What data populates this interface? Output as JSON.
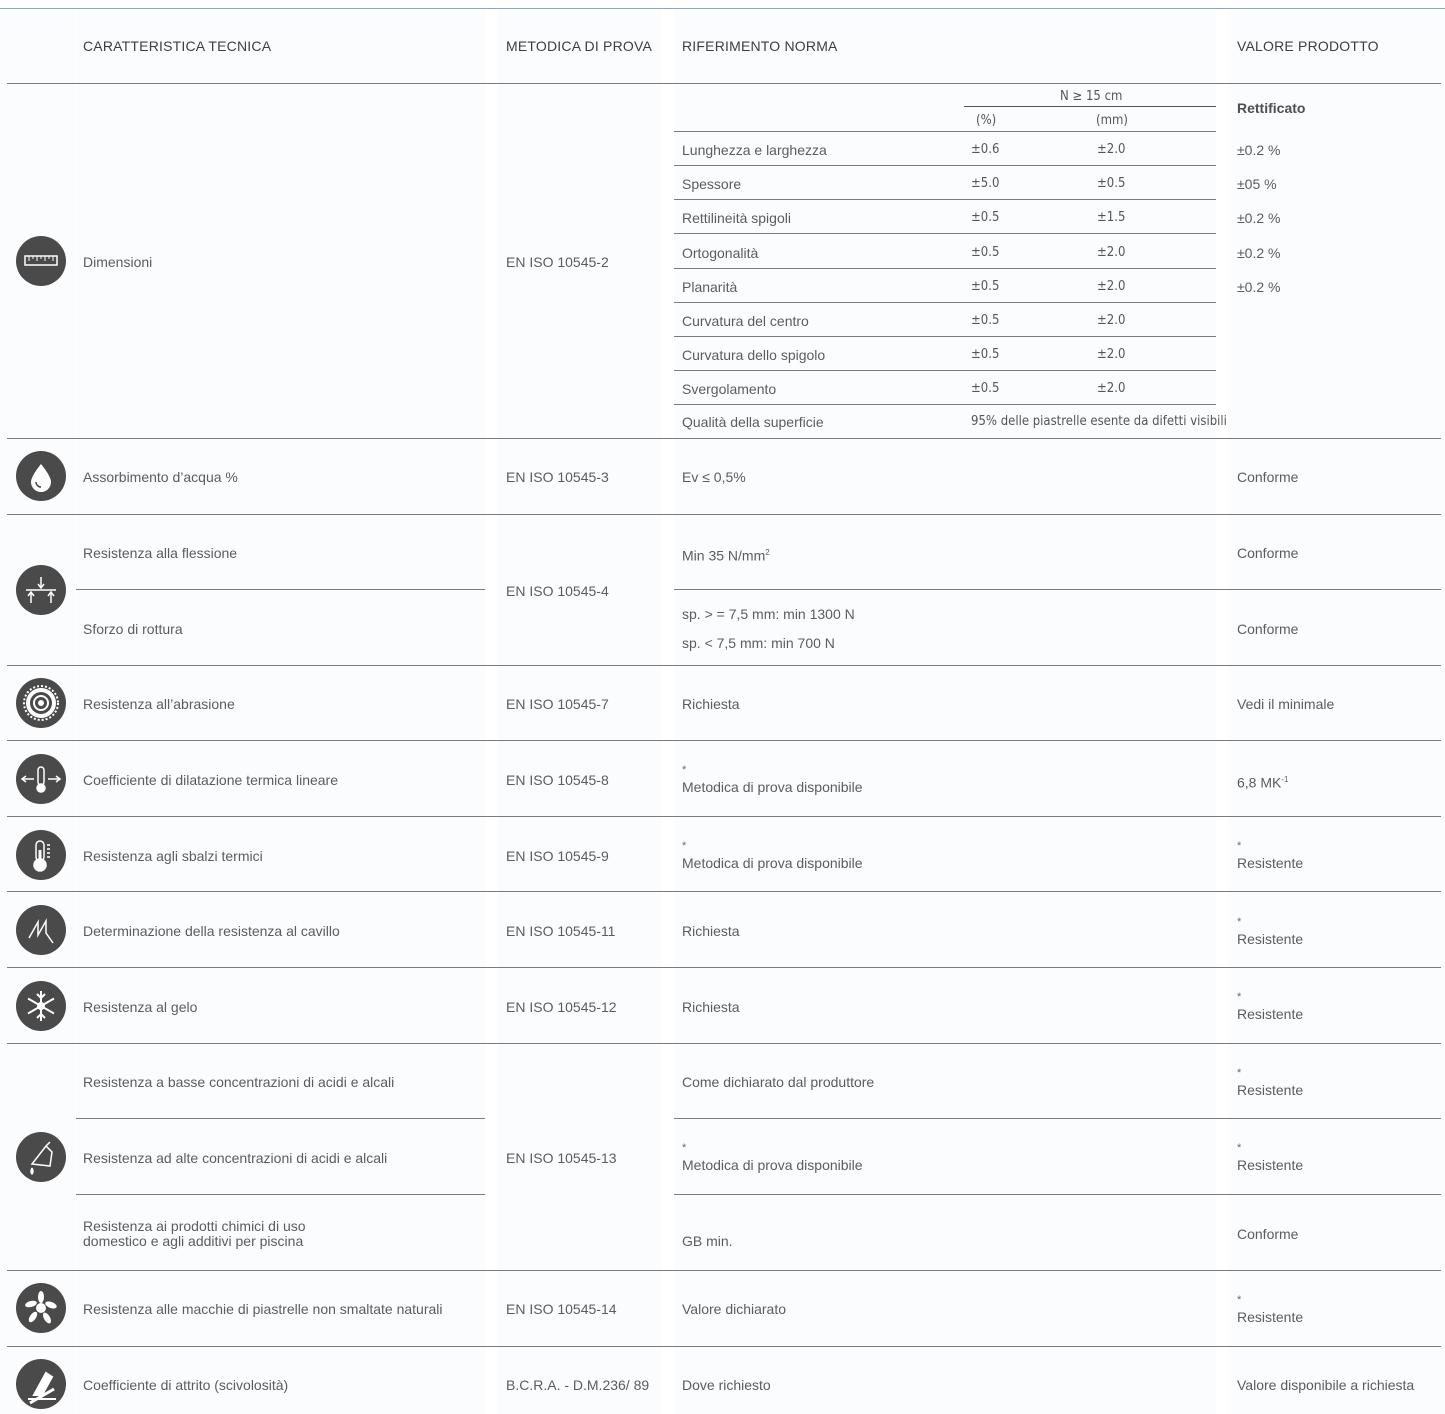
{
  "headers": {
    "caratteristica": "CARATTERISTICA TECNICA",
    "metodica": "METODICA DI PROVA",
    "riferimento": "RIFERIMENTO NORMA",
    "valore": "VALORE PRODOTTO"
  },
  "dimensioni": {
    "name": "Dimensioni",
    "method": "EN ISO 10545-2",
    "group_header": "N ≥ 15 cm",
    "col_pct": "(%)",
    "col_mm": "(mm)",
    "value_title": "Rettificato",
    "rows": [
      {
        "label": "Lunghezza e larghezza",
        "pct": "±0.6",
        "mm": "±2.0",
        "value": "±0.2 %"
      },
      {
        "label": "Spessore",
        "pct": "±5.0",
        "mm": "±0.5",
        "value": "±05 %"
      },
      {
        "label": "Rettilineità spigoli",
        "pct": "±0.5",
        "mm": "±1.5",
        "value": "±0.2 %"
      },
      {
        "label": "Ortogonalità",
        "pct": "±0.5",
        "mm": "±2.0",
        "value": "±0.2 %"
      },
      {
        "label": "Planarità",
        "pct": "±0.5",
        "mm": "±2.0",
        "value": "±0.2 %"
      },
      {
        "label": "Curvatura del centro",
        "pct": "±0.5",
        "mm": "±2.0",
        "value": ""
      },
      {
        "label": "Curvatura dello spigolo",
        "pct": "±0.5",
        "mm": "±2.0",
        "value": ""
      },
      {
        "label": "Svergolamento",
        "pct": "±0.5",
        "mm": "±2.0",
        "value": ""
      }
    ],
    "surface_label": "Qualità della superficie",
    "surface_value": "95% delle piastrelle esente da difetti visibili"
  },
  "assorbimento": {
    "name": "Assorbimento d’acqua %",
    "method": "EN ISO 10545-3",
    "norm": "Ev ≤ 0,5%",
    "value": "Conforme"
  },
  "flessione": {
    "method": "EN ISO 10545-4",
    "name1": "Resistenza alla flessione",
    "norm1": "Min 35 N/mm",
    "norm1_sup": "2",
    "value1": "Conforme",
    "name2": "Sforzo di rottura",
    "norm2a": "sp. > = 7,5 mm: min 1300 N",
    "norm2b": "sp. < 7,5 mm: min 700 N",
    "value2": "Conforme"
  },
  "abrasione": {
    "name": "Resistenza all’abrasione",
    "method": "EN ISO 10545-7",
    "norm": "Richiesta",
    "value": "Vedi il minimale"
  },
  "dilatazione": {
    "name": "Coefficiente di dilatazione termica lineare",
    "method": "EN ISO 10545-8",
    "asterisk": "*",
    "norm": "Metodica di prova disponibile",
    "value": "6,8 MK",
    "value_sup": "-1"
  },
  "sbalzi": {
    "name": "Resistenza agli sbalzi termici",
    "method": "EN ISO 10545-9",
    "asterisk": "*",
    "norm": "Metodica di prova disponibile",
    "value_asterisk": "*",
    "value": "Resistente"
  },
  "cavillo": {
    "name": "Determinazione della resistenza al cavillo",
    "method": "EN ISO 10545-11",
    "norm": "Richiesta",
    "value_asterisk": "*",
    "value": "Resistente"
  },
  "gelo": {
    "name": "Resistenza al gelo",
    "method": "EN ISO 10545-12",
    "norm": "Richiesta",
    "value_asterisk": "*",
    "value": "Resistente"
  },
  "chimici": {
    "method": "EN ISO 10545-13",
    "name1": "Resistenza a basse concentrazioni di acidi e alcali",
    "norm1": "Come dichiarato dal produttore",
    "value1_asterisk": "*",
    "value1": "Resistente",
    "name2": "Resistenza ad alte concentrazioni di acidi e alcali",
    "norm2_asterisk": "*",
    "norm2": "Metodica di prova disponibile",
    "value2_asterisk": "*",
    "value2": "Resistente",
    "name3a": "Resistenza ai prodotti chimici di uso",
    "name3b": "domestico e agli additivi per piscina",
    "norm3": "GB min.",
    "value3": "Conforme"
  },
  "macchie": {
    "name": "Resistenza alle macchie di piastrelle non smaltate naturali",
    "method": "EN ISO 10545-14",
    "norm": "Valore dichiarato",
    "value_asterisk": "*",
    "value": "Resistente"
  },
  "attrito": {
    "name": "Coefficiente di attrito (scivolosità)",
    "method": "B.C.R.A. - D.M.236/ 89",
    "norm": "Dove richiesto",
    "value": "Valore disponibile a richiesta"
  },
  "icons": [
    "ruler-icon",
    "water-drop-icon",
    "flexion-icon",
    "abrasion-disc-icon",
    "thermal-expansion-icon",
    "thermometer-icon",
    "crack-icon",
    "snowflake-icon",
    "chemical-flask-icon",
    "stain-icon",
    "friction-shoe-icon"
  ],
  "colors": {
    "icon_bg": "#4a4a4a",
    "rule": "#7b7b7b",
    "top_rule": "#8fa6b3",
    "text": "#5c5c5c"
  }
}
